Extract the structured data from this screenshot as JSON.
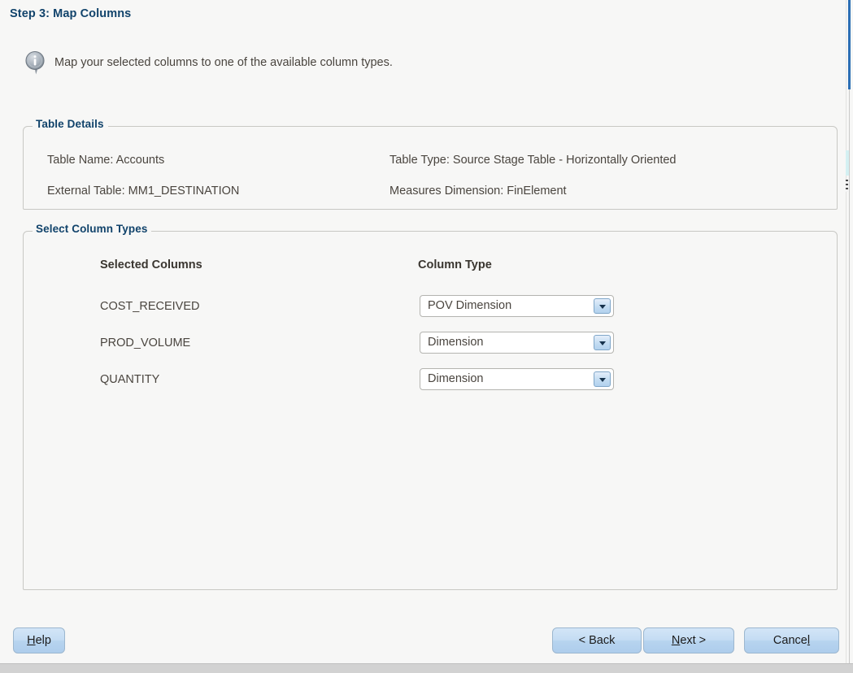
{
  "window": {
    "step_title": "Step 3: Map Columns",
    "instruction": "Map your selected columns to one of the available column types.",
    "info_icon": "info-icon"
  },
  "table_details": {
    "legend": "Table Details",
    "table_name": "Table Name: Accounts",
    "table_type": "Table Type: Source Stage Table - Horizontally Oriented",
    "external_table": "External Table: MM1_DESTINATION",
    "measures_dimension": "Measures Dimension: FinElement"
  },
  "select_column_types": {
    "legend": "Select Column Types",
    "headers": {
      "selected_columns": "Selected Columns",
      "column_type": "Column Type"
    },
    "rows": [
      {
        "column": "COST_RECEIVED",
        "type": "POV Dimension"
      },
      {
        "column": "PROD_VOLUME",
        "type": "Dimension"
      },
      {
        "column": "QUANTITY",
        "type": "Dimension"
      }
    ],
    "dropdown_icon": "chevron-down-icon"
  },
  "buttons": {
    "help": {
      "pre": "H",
      "post": "elp",
      "mnemonic": "H"
    },
    "back": {
      "pre": "< B",
      "post": "ack",
      "mnemonic": "B"
    },
    "next": {
      "pre": "N",
      "post": "ext >",
      "mnemonic": "N"
    },
    "cancel": {
      "pre": "Cance",
      "post": "l",
      "mnemonic": "l"
    }
  },
  "colors": {
    "title": "#11436b",
    "legend": "#11436b",
    "text": "#4a453f",
    "background": "#f7f7f6",
    "button_blue": "#c4dcf3",
    "panel_border": "#c8c8c4"
  }
}
